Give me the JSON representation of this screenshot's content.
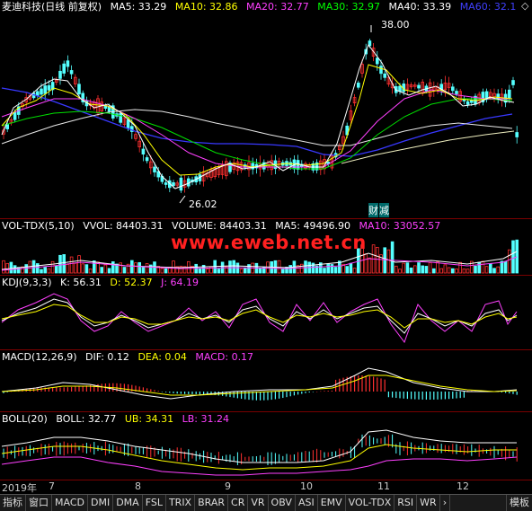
{
  "main": {
    "title": "麦迪科技(日线 前复权)",
    "ma": [
      {
        "label": "MA5: 33.29",
        "color": "#ffffff"
      },
      {
        "label": "MA10: 32.86",
        "color": "#ffff00"
      },
      {
        "label": "MA20: 32.77",
        "color": "#ff40ff"
      },
      {
        "label": "MA30: 32.97",
        "color": "#00ff00"
      },
      {
        "label": "MA40: 33.39",
        "color": "#ffffff"
      },
      {
        "label": "MA60: 32.1",
        "color": "#4040ff"
      }
    ],
    "high_label": "38.00",
    "low_label": "26.02",
    "finance_marker": "财",
    "reduce_marker": "减",
    "diamond": "◇"
  },
  "volume": {
    "name": "VOL-TDX(5,10)",
    "vvol": "VVOL: 84403.31",
    "volume": "VOLUME: 84403.31",
    "ma5": "MA5: 49496.90",
    "ma10": "MA10: 33052.57"
  },
  "watermark": "www.eweb.net.cn",
  "kdj": {
    "name": "KDJ(9,3,3)",
    "k": "K: 56.31",
    "d": "D: 52.37",
    "j": "J: 64.19"
  },
  "macd": {
    "name": "MACD(12,26,9)",
    "dif": "DIF: 0.12",
    "dea": "DEA: 0.04",
    "macd": "MACD: 0.17"
  },
  "boll": {
    "name": "BOLL(20)",
    "boll": "BOLL: 32.77",
    "ub": "UB: 34.31",
    "lb": "LB: 31.24"
  },
  "xaxis": [
    "2019年",
    "7",
    "8",
    "9",
    "10",
    "11",
    "12"
  ],
  "tabs": [
    "指标",
    "窗口",
    "MACD",
    "DMI",
    "DMA",
    "FSL",
    "TRIX",
    "BRAR",
    "CR",
    "VR",
    "OBV",
    "ASI",
    "EMV",
    "VOL-TDX",
    "RSI",
    "WR"
  ],
  "tabs_more": "›",
  "tab_right": "模板",
  "colors": {
    "up": "#ff3030",
    "down": "#54ffff",
    "border": "#7a0000",
    "bg": "#000000"
  }
}
